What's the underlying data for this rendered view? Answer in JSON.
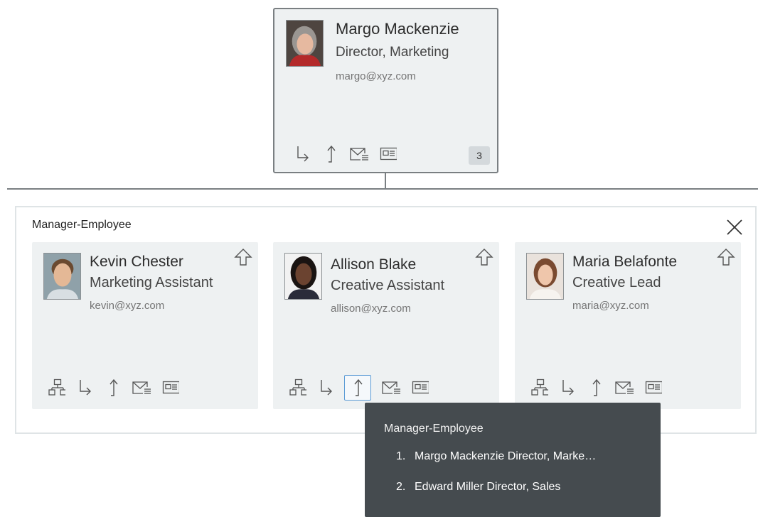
{
  "manager": {
    "name": "Margo Mackenzie",
    "title": "Director, Marketing",
    "email": "margo@xyz.com",
    "report_count": "3",
    "avatar": "margo-photo"
  },
  "panel": {
    "title": "Manager-Employee",
    "close_icon": "close-icon"
  },
  "employees": [
    {
      "name": "Kevin Chester",
      "title": "Marketing Assistant",
      "email": "kevin@xyz.com",
      "avatar": "kevin-photo"
    },
    {
      "name": "Allison Blake",
      "title": "Creative Assistant",
      "email": "allison@xyz.com",
      "avatar": "allison-photo"
    },
    {
      "name": "Maria Belafonte",
      "title": "Creative Lead",
      "email": "maria@xyz.com",
      "avatar": "maria-photo"
    }
  ],
  "tooltip": {
    "title": "Manager-Employee",
    "items": [
      {
        "num": "1.",
        "text": "Margo Mackenzie Director, Marke…"
      },
      {
        "num": "2.",
        "text": "Edward Miller Director, Sales"
      }
    ]
  },
  "icons": [
    "org-chart-icon",
    "child-arrow-icon",
    "up-arrow-icon",
    "mail-icon",
    "contact-card-icon",
    "go-up-icon"
  ]
}
